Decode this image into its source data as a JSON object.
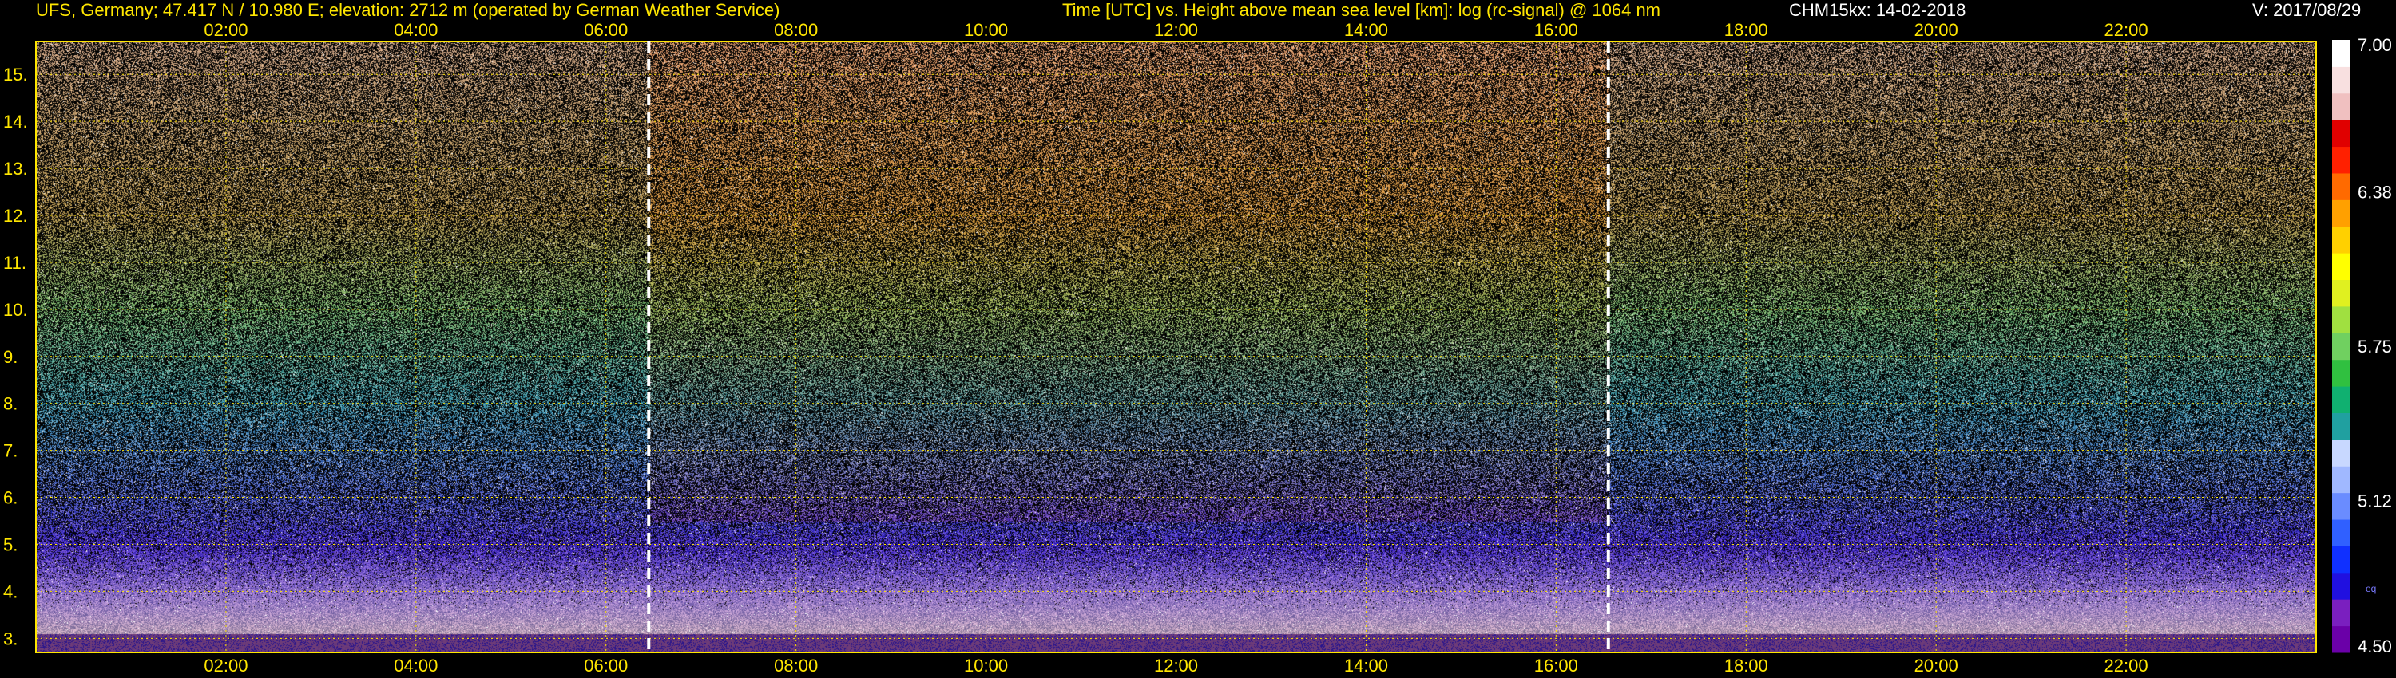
{
  "header": {
    "station": "UFS, Germany; 47.417 N / 10.980 E; elevation: 2712 m  (operated by German Weather Service)",
    "plot_title": "Time [UTC] vs. Height above mean sea level [km]: log (rc-signal) @ 1064 nm",
    "instrument_date": "CHM15kx: 14-02-2018",
    "version": "V: 2017/08/29"
  },
  "colorbar": {
    "labels": [
      "7.00",
      "6.38",
      "5.75",
      "5.12",
      "4.50"
    ],
    "annotation": "eq",
    "colors": [
      "#6a00a8",
      "#7a1fbf",
      "#2010e0",
      "#1030ff",
      "#3060ff",
      "#6a8cff",
      "#a0b8ff",
      "#c8d8ff",
      "#20a0a0",
      "#10b070",
      "#30c040",
      "#70d060",
      "#a0e040",
      "#e0f020",
      "#ffff00",
      "#ffd000",
      "#ffa000",
      "#ff6a00",
      "#ff2000",
      "#e00000",
      "#f0c0c0",
      "#f8e0e0",
      "#ffffff"
    ]
  },
  "chart_data": {
    "type": "heatmap",
    "title": "Time [UTC] vs. Height above mean sea level [km]: log (rc-signal) @ 1064 nm",
    "xlabel": "Time [UTC]",
    "ylabel": "Height above mean sea level [km]",
    "x_ticks": [
      "02:00",
      "04:00",
      "06:00",
      "08:00",
      "10:00",
      "12:00",
      "14:00",
      "16:00",
      "18:00",
      "20:00",
      "22:00"
    ],
    "y_ticks": [
      "3.",
      "4.",
      "5.",
      "6.",
      "7.",
      "8.",
      "9.",
      "10.",
      "11.",
      "12.",
      "13.",
      "14.",
      "15."
    ],
    "xlim_hours": [
      0,
      24
    ],
    "ylim_km": [
      2.7,
      15.7
    ],
    "colorbar_range": [
      4.5,
      7.0
    ],
    "grid": true,
    "vertical_markers_hours": [
      6.45,
      16.55
    ],
    "boundary_layer_top_km": 3.1,
    "noise_gradient": [
      {
        "height_km": 3.1,
        "color": "#b49ab4"
      },
      {
        "height_km": 4.0,
        "color": "#8c6ec8"
      },
      {
        "height_km": 5.0,
        "color": "#4a30c8"
      },
      {
        "height_km": 6.5,
        "color": "#5a7ad2"
      },
      {
        "height_km": 8.0,
        "color": "#4aa0b4"
      },
      {
        "height_km": 10.0,
        "color": "#7ab46e"
      },
      {
        "height_km": 12.0,
        "color": "#b49650"
      },
      {
        "height_km": 15.7,
        "color": "#c8a082"
      }
    ]
  }
}
